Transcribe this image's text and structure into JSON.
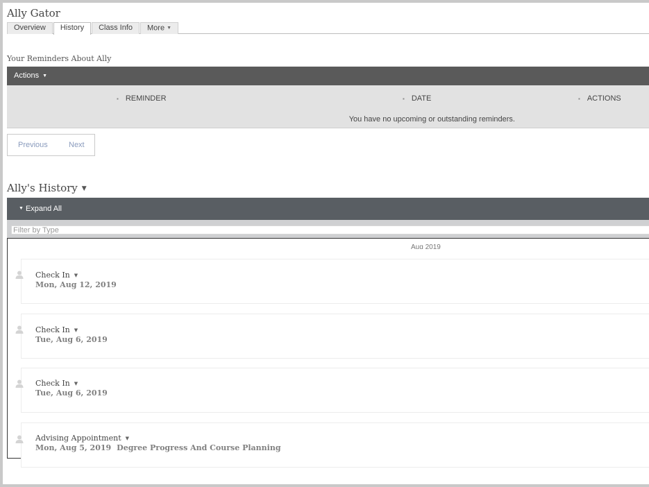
{
  "student": {
    "name": "Ally Gator"
  },
  "tabs": [
    {
      "label": "Overview"
    },
    {
      "label": "History"
    },
    {
      "label": "Class Info"
    },
    {
      "label": "More"
    }
  ],
  "reminders": {
    "heading": "Your Reminders About Ally",
    "actions_label": "Actions",
    "columns": [
      "REMINDER",
      "DATE",
      "ACTIONS"
    ],
    "empty_message": "You have no upcoming or outstanding reminders.",
    "pager": {
      "previous": "Previous",
      "next": "Next"
    }
  },
  "history": {
    "title": "Ally's History",
    "expand_all": "Expand All",
    "filter_placeholder": "Filter by Type",
    "month_label": "Aug 2019",
    "entries": [
      {
        "title": "Check In",
        "date": "Mon, Aug 12, 2019",
        "description": ""
      },
      {
        "title": "Check In",
        "date": "Tue, Aug 6, 2019",
        "description": ""
      },
      {
        "title": "Check In",
        "date": "Tue, Aug 6, 2019",
        "description": ""
      },
      {
        "title": "Advising Appointment",
        "date": "Mon, Aug 5, 2019",
        "description": "Degree Progress And Course Planning"
      }
    ]
  },
  "colors": {
    "actions_bar": "#5a5a5a",
    "expand_bar": "#595e63",
    "table_bg": "#e2e2e2",
    "pager_link": "#8a9bbd"
  },
  "icons": {
    "entry_icon": "person-icon",
    "dropdown": "caret-down-icon"
  }
}
